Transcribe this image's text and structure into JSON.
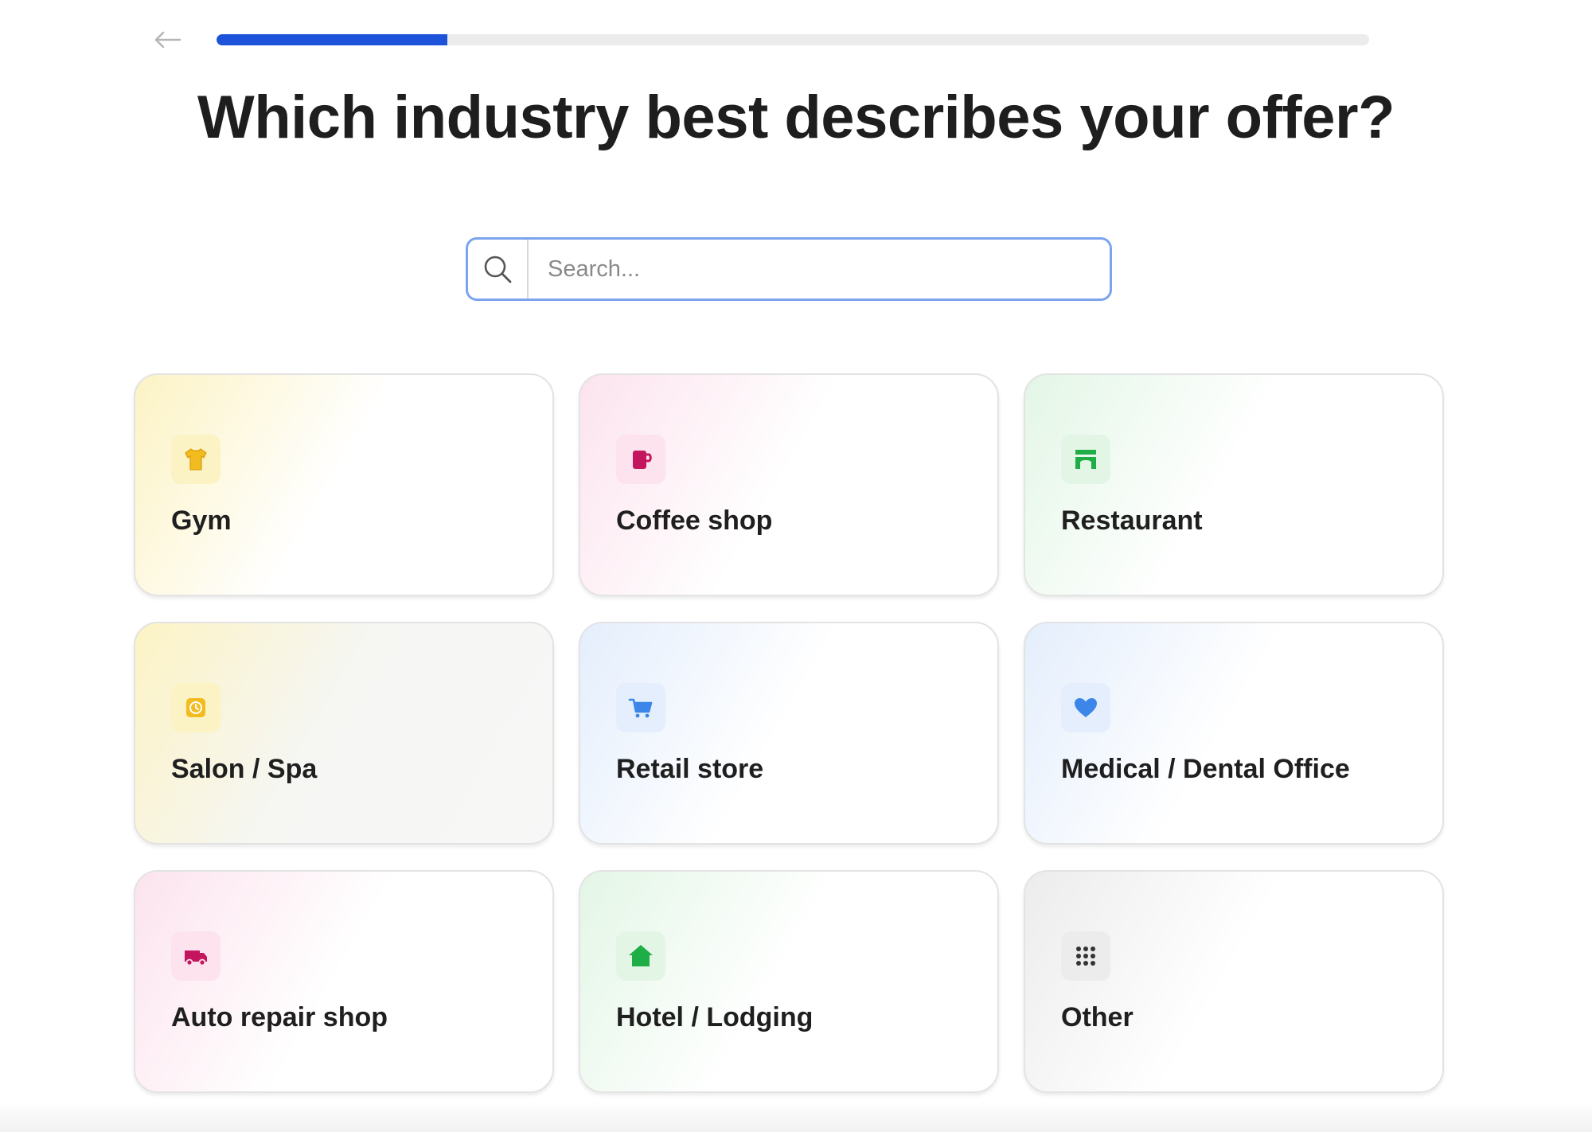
{
  "header": {
    "back_icon": "arrow-left-icon",
    "progress_percent": 20,
    "progress_color": "#1d53d9"
  },
  "title": "Which industry best describes your offer?",
  "search": {
    "placeholder": "Search...",
    "value": "",
    "icon": "search-icon",
    "border_color": "#7ba4ee"
  },
  "industries": [
    {
      "label": "Gym",
      "icon": "tshirt-icon",
      "accent": "#f2c12e",
      "tile_bg": "#fcf3c4"
    },
    {
      "label": "Coffee shop",
      "icon": "coffee-mug-icon",
      "accent": "#c4165e",
      "tile_bg": "#fce3ee"
    },
    {
      "label": "Restaurant",
      "icon": "storefront-icon",
      "accent": "#22b14c",
      "tile_bg": "#e3f6e6"
    },
    {
      "label": "Salon / Spa",
      "icon": "clock-icon",
      "accent": "#f2c12e",
      "tile_bg": "#fcf3c4"
    },
    {
      "label": "Retail store",
      "icon": "shopping-cart-icon",
      "accent": "#3b86e8",
      "tile_bg": "#e4eefc"
    },
    {
      "label": "Medical / Dental Office",
      "icon": "heart-icon",
      "accent": "#3b86e8",
      "tile_bg": "#e4eefc"
    },
    {
      "label": "Auto repair shop",
      "icon": "truck-icon",
      "accent": "#c4165e",
      "tile_bg": "#fce3ee"
    },
    {
      "label": "Hotel / Lodging",
      "icon": "house-icon",
      "accent": "#22b14c",
      "tile_bg": "#e3f6e6"
    },
    {
      "label": "Other",
      "icon": "grid-dots-icon",
      "accent": "#333333",
      "tile_bg": "#ececec"
    }
  ]
}
